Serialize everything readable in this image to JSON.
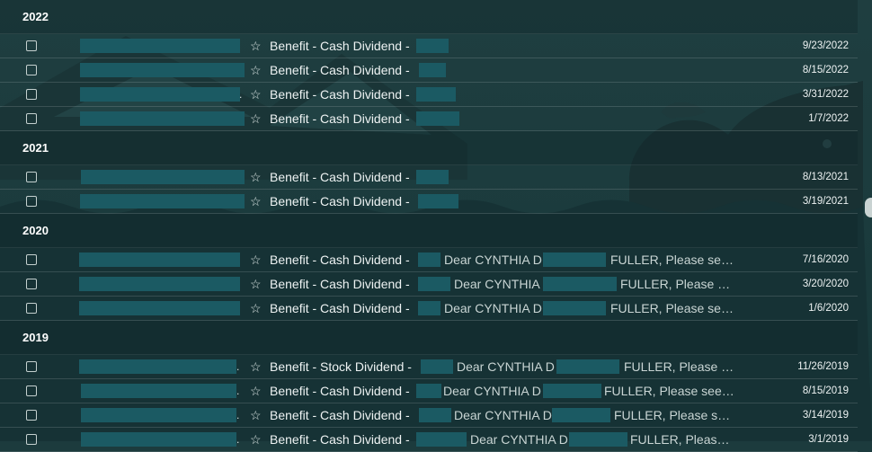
{
  "sections": [
    {
      "year": "2022",
      "rows": [
        {
          "subject": "Benefit - Cash Dividend -",
          "snippet": "",
          "date": "9/23/2022"
        },
        {
          "subject": "Benefit - Cash Dividend -",
          "snippet": "",
          "date": "8/15/2022"
        },
        {
          "subject": "Benefit - Cash Dividend -",
          "snippet": "",
          "date": "3/31/2022"
        },
        {
          "subject": "Benefit - Cash Dividend -",
          "snippet": "",
          "date": "1/7/2022"
        }
      ]
    },
    {
      "year": "2021",
      "rows": [
        {
          "subject": "Benefit - Cash Dividend -",
          "snippet": "",
          "date": "8/13/2021"
        },
        {
          "subject": "Benefit - Cash Dividend -",
          "snippet": "",
          "date": "3/19/2021"
        }
      ]
    },
    {
      "year": "2020",
      "rows": [
        {
          "subject": "Benefit - Cash Dividend -",
          "snippet": "Dear CYNTHIA D",
          "snippet2": "FULLER, Please se…",
          "date": "7/16/2020"
        },
        {
          "subject": "Benefit - Cash Dividend -",
          "snippet": "Dear CYNTHIA D",
          "snippet2": "FULLER, Please …",
          "date": "3/20/2020"
        },
        {
          "subject": "Benefit - Cash Dividend -",
          "snippet": "Dear CYNTHIA D",
          "snippet2": "FULLER, Please se…",
          "date": "1/6/2020"
        }
      ]
    },
    {
      "year": "2019",
      "rows": [
        {
          "subject": "Benefit - Stock Dividend -",
          "snippet": "Dear CYNTHIA D",
          "snippet2": "FULLER, Please …",
          "date": "11/26/2019"
        },
        {
          "subject": "Benefit - Cash Dividend -",
          "snippet": "Dear CYNTHIA D",
          "snippet2": "FULLER, Please see…",
          "date": "8/15/2019"
        },
        {
          "subject": "Benefit - Cash Dividend -",
          "snippet": "Dear CYNTHIA D",
          "snippet2": "FULLER, Please s…",
          "date": "3/14/2019"
        },
        {
          "subject": "Benefit - Cash Dividend -",
          "snippet": "Dear CYNTHIA D",
          "snippet2": "FULLER, Pleas…",
          "date": "3/1/2019"
        }
      ]
    }
  ],
  "icons": {
    "star": "star-outline-icon",
    "checkbox": "checkbox-icon"
  },
  "colors": {
    "background": "#1c3b3d",
    "redaction": "#1b5a63",
    "text": "#eef3f3"
  }
}
